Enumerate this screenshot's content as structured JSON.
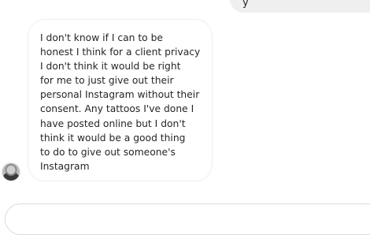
{
  "thread": {
    "sent_message": {
      "visible_text": "y"
    },
    "received_message": {
      "text": "I don't know if I can to be\nhonest I think for a client privacy\nI don't think it would be right\nfor me to just give out their\npersonal Instagram without their\nconsent. Any tattoos I've done I\nhave posted online but I don't\nthink it would be a good thing\nto do to give out someone's\nInstagram"
    }
  },
  "composer": {
    "placeholder": ""
  }
}
